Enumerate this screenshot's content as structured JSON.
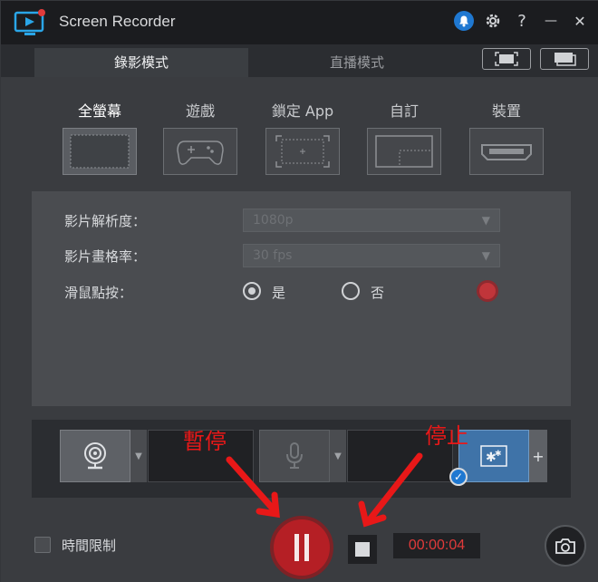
{
  "app": {
    "title": "Screen Recorder"
  },
  "titlebar": {
    "icons": [
      "bell-icon",
      "gear-icon",
      "help-icon",
      "minimize-icon",
      "close-icon"
    ],
    "help_glyph": "?",
    "minimize_glyph": "—",
    "close_glyph": "✕"
  },
  "tabs": [
    {
      "label": "錄影模式",
      "active": true
    },
    {
      "label": "直播模式",
      "active": false
    }
  ],
  "capture_options": [
    {
      "label": "全螢幕",
      "active": true
    },
    {
      "label": "遊戲",
      "active": false
    },
    {
      "label": "鎖定 App",
      "active": false
    },
    {
      "label": "自訂",
      "active": false
    },
    {
      "label": "裝置",
      "active": false
    }
  ],
  "settings": {
    "resolution_label": "影片解析度：",
    "resolution_value": "1080p",
    "framerate_label": "影片畫格率：",
    "framerate_value": "30 fps",
    "mouse_click_label": "滑鼠點按：",
    "yes_label": "是",
    "no_label": "否",
    "selected": "yes"
  },
  "bottom": {
    "time_limit_label": "時間限制",
    "timer": "00:00:04"
  },
  "annotations": {
    "pause_text": "暫停",
    "stop_text": "停止",
    "color": "#e81818"
  },
  "colors": {
    "accent": "#1f78d1",
    "record": "#b51f25",
    "timer": "#e03a3a"
  }
}
